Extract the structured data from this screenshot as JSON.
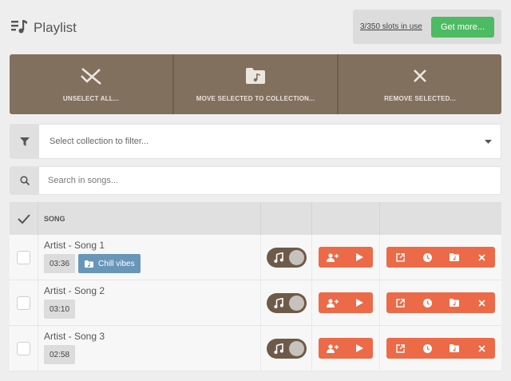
{
  "header": {
    "title": "Playlist",
    "title_icon": "playlist-icon"
  },
  "slots": {
    "usage_text": "3/350 slots in use",
    "get_more_label": "Get more..."
  },
  "actions": [
    {
      "label": "UNSELECT ALL...",
      "icon": "unselect-all-icon"
    },
    {
      "label": "MOVE SELECTED TO COLLECTION...",
      "icon": "music-folder-icon"
    },
    {
      "label": "REMOVE SELECTED...",
      "icon": "close-icon"
    }
  ],
  "filter": {
    "placeholder": "Select collection to filter...",
    "icon": "filter-icon"
  },
  "search": {
    "placeholder": "Search in songs...",
    "icon": "search-icon"
  },
  "table": {
    "header": {
      "song_label": "SONG"
    },
    "rows": [
      {
        "title": "Artist - Song 1",
        "duration": "03:36",
        "collection": "Chill vibes"
      },
      {
        "title": "Artist - Song 2",
        "duration": "03:10"
      },
      {
        "title": "Artist - Song 3",
        "duration": "02:58"
      }
    ]
  },
  "colors": {
    "accent_orange": "#ec6a47",
    "action_brown": "#82705f",
    "success_green": "#4dbb63",
    "collection_blue": "#6896b9"
  }
}
